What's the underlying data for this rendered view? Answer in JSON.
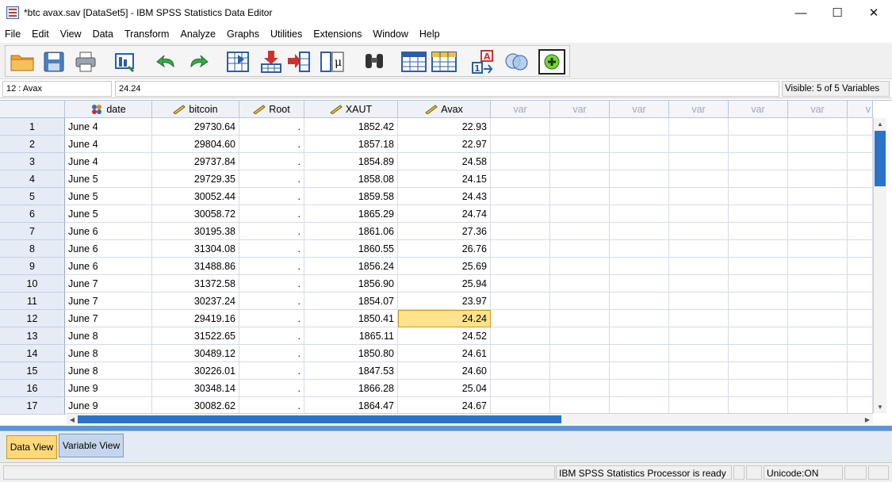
{
  "window": {
    "title": "*btc avax.sav [DataSet5] - IBM SPSS Statistics Data Editor",
    "minimize": "—",
    "maximize": "☐",
    "close": "✕"
  },
  "menu": [
    "File",
    "Edit",
    "View",
    "Data",
    "Transform",
    "Analyze",
    "Graphs",
    "Utilities",
    "Extensions",
    "Window",
    "Help"
  ],
  "toolbar": {
    "icons": [
      "open-folder-icon",
      "save-icon",
      "print-icon",
      "dialog-recall-icon",
      "undo-icon",
      "redo-icon",
      "goto-case-icon",
      "insert-cases-icon",
      "insert-variable-icon",
      "variables-icon",
      "find-icon",
      "split-file-icon",
      "select-cases-icon",
      "value-labels-icon",
      "use-sets-icon",
      "spell-check-icon"
    ]
  },
  "cellbar": {
    "ref": "12 : Avax",
    "value": "24.24",
    "visible": "Visible: 5 of 5 Variables"
  },
  "columns": [
    {
      "name": "date",
      "type": "nominal"
    },
    {
      "name": "bitcoin",
      "type": "scale"
    },
    {
      "name": "Root",
      "type": "scale"
    },
    {
      "name": "XAUT",
      "type": "scale"
    },
    {
      "name": "Avax",
      "type": "scale"
    }
  ],
  "empty_var_label": "var",
  "empty_var_partial": "v",
  "rows": [
    {
      "n": "1",
      "date": "June 4",
      "bitcoin": "29730.64",
      "root": ".",
      "xaut": "1852.42",
      "avax": "22.93"
    },
    {
      "n": "2",
      "date": "June 4",
      "bitcoin": "29804.60",
      "root": ".",
      "xaut": "1857.18",
      "avax": "22.97"
    },
    {
      "n": "3",
      "date": "June 4",
      "bitcoin": "29737.84",
      "root": ".",
      "xaut": "1854.89",
      "avax": "24.58"
    },
    {
      "n": "4",
      "date": "June 5",
      "bitcoin": "29729.35",
      "root": ".",
      "xaut": "1858.08",
      "avax": "24.15"
    },
    {
      "n": "5",
      "date": "June 5",
      "bitcoin": "30052.44",
      "root": ".",
      "xaut": "1859.58",
      "avax": "24.43"
    },
    {
      "n": "6",
      "date": "June 5",
      "bitcoin": "30058.72",
      "root": ".",
      "xaut": "1865.29",
      "avax": "24.74"
    },
    {
      "n": "7",
      "date": "June 6",
      "bitcoin": "30195.38",
      "root": ".",
      "xaut": "1861.06",
      "avax": "27.36"
    },
    {
      "n": "8",
      "date": "June 6",
      "bitcoin": "31304.08",
      "root": ".",
      "xaut": "1860.55",
      "avax": "26.76"
    },
    {
      "n": "9",
      "date": "June 6",
      "bitcoin": "31488.86",
      "root": ".",
      "xaut": "1856.24",
      "avax": "25.69"
    },
    {
      "n": "10",
      "date": "June 7",
      "bitcoin": "31372.58",
      "root": ".",
      "xaut": "1856.90",
      "avax": "25.94"
    },
    {
      "n": "11",
      "date": "June 7",
      "bitcoin": "30237.24",
      "root": ".",
      "xaut": "1854.07",
      "avax": "23.97"
    },
    {
      "n": "12",
      "date": "June 7",
      "bitcoin": "29419.16",
      "root": ".",
      "xaut": "1850.41",
      "avax": "24.24"
    },
    {
      "n": "13",
      "date": "June 8",
      "bitcoin": "31522.65",
      "root": ".",
      "xaut": "1865.11",
      "avax": "24.52"
    },
    {
      "n": "14",
      "date": "June 8",
      "bitcoin": "30489.12",
      "root": ".",
      "xaut": "1850.80",
      "avax": "24.61"
    },
    {
      "n": "15",
      "date": "June 8",
      "bitcoin": "30226.01",
      "root": ".",
      "xaut": "1847.53",
      "avax": "24.60"
    },
    {
      "n": "16",
      "date": "June 9",
      "bitcoin": "30348.14",
      "root": ".",
      "xaut": "1866.28",
      "avax": "25.04"
    },
    {
      "n": "17",
      "date": "June 9",
      "bitcoin": "30082.62",
      "root": ".",
      "xaut": "1864.47",
      "avax": "24.67"
    }
  ],
  "selected": {
    "row": 12,
    "column": "Avax"
  },
  "tabs": {
    "data_view": "Data View",
    "variable_view": "Variable View",
    "active": "Data View"
  },
  "status": {
    "processor": "IBM SPSS Statistics Processor is ready",
    "unicode": "Unicode:ON"
  },
  "colors": {
    "selected_cell": "#ffe28c",
    "active_tab": "#ffd87a",
    "scroll_thumb": "#2a73c8",
    "header_bg": "#eef2f7"
  }
}
